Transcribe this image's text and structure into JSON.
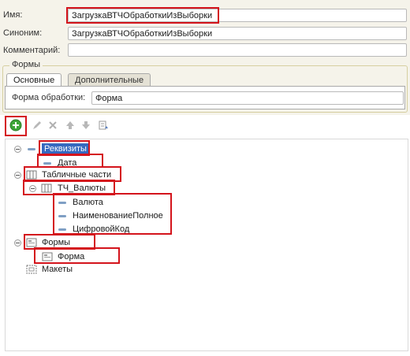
{
  "form": {
    "name_label": "Имя:",
    "name_value": "ЗагрузкаВТЧОбработкиИзВыборки",
    "synonym_label": "Синоним:",
    "synonym_value": "ЗагрузкаВТЧОбработкиИзВыборки",
    "comment_label": "Комментарий:",
    "comment_value": ""
  },
  "forms_group": {
    "title": "Формы",
    "tabs": [
      {
        "label": "Основные",
        "active": true
      },
      {
        "label": "Дополнительные",
        "active": false
      }
    ],
    "processing_form_label": "Форма обработки:",
    "processing_form_value": "Форма"
  },
  "toolbar": {
    "buttons": [
      "add-icon",
      "edit-icon",
      "delete-icon",
      "move-up-icon",
      "move-down-icon",
      "sort-icon"
    ]
  },
  "tree": {
    "attributes": {
      "label": "Реквизиты",
      "children": [
        "Дата"
      ]
    },
    "tabular_parts": {
      "label": "Табличные части",
      "part": {
        "label": "ТЧ_Валюты",
        "children": [
          "Валюта",
          "НаименованиеПолное",
          "ЦифровойКод"
        ]
      }
    },
    "forms": {
      "label": "Формы",
      "children": [
        "Форма"
      ]
    },
    "layouts": {
      "label": "Макеты"
    }
  },
  "colors": {
    "highlight": "#d4141c",
    "selection": "#3569c0",
    "panel": "#f5f3ea"
  }
}
